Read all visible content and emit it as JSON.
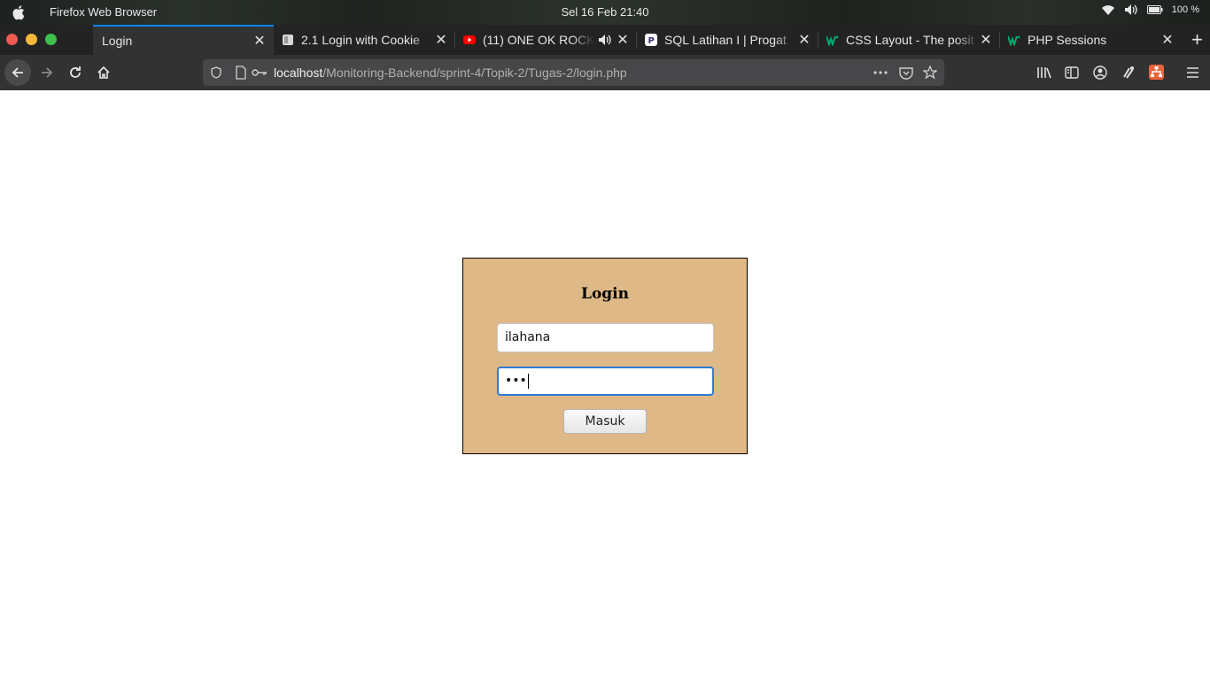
{
  "os": {
    "app_name": "Firefox Web Browser",
    "clock": "Sel 16 Feb  21:40",
    "battery": "100 %"
  },
  "tabs": [
    {
      "label": "Login",
      "active": true,
      "favicon": "none"
    },
    {
      "label": "2.1 Login with Cookie",
      "active": false,
      "favicon": "page-icon"
    },
    {
      "label": "(11) ONE OK ROCK",
      "active": false,
      "favicon": "youtube-icon"
    },
    {
      "label": "SQL Latihan I | Progat",
      "active": false,
      "favicon": "progate-icon"
    },
    {
      "label": "CSS Layout - The posit",
      "active": false,
      "favicon": "w3schools-icon"
    },
    {
      "label": "PHP Sessions",
      "active": false,
      "favicon": "w3schools-icon"
    }
  ],
  "navbar": {
    "url_host": "localhost",
    "url_path": "/Monitoring-Backend/sprint-4/Topik-2/Tugas-2/login.php"
  },
  "login": {
    "title": "Login",
    "username_value": "ilahana",
    "password_mask": "•••",
    "submit_label": "Masuk"
  },
  "colors": {
    "form_background": "#deb887",
    "focus_border": "#2f7bd6",
    "tab_accent": "#0a84ff"
  }
}
